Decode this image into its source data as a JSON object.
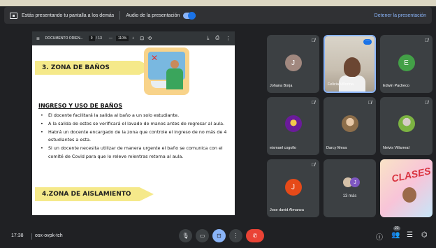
{
  "banner": {
    "presenting_text": "Estás presentando tu pantalla a los demás",
    "audio_label": "Audio de la presentación",
    "audio_on": true,
    "stop_label": "Detener la presentación"
  },
  "doc": {
    "toolbar": {
      "title": "DOCUMENTO ORIEN...",
      "page_current": "9",
      "page_total": "/ 13",
      "zoom_minus": "—",
      "zoom_value": "110%",
      "zoom_plus": "+"
    },
    "zone3_title": "3. ZONA DE BAÑOS",
    "section_title": "INGRESO Y USO DE BAÑOS",
    "bullets": [
      "El docente facilitará la salida al baño a un solo estudiante.",
      "A la salida de estos se verificará el lavado de manos antes de regresar al aula.",
      "Habrá un docente encargado de la zona que controle el ingreso de no más de 4 estudiantes a esta.",
      "Si un docente necesita utilizar de manera urgente el baño se comunica con el comité de Covid para que lo releve mientras retorna al aula."
    ],
    "zone4_title": "4.ZONA DE AISLAMIENTO"
  },
  "participants": [
    {
      "name": "Johana Borja",
      "initial": "J",
      "color": "#a1887f"
    },
    {
      "name": "Felicia Villorina",
      "initial": "",
      "color": ""
    },
    {
      "name": "Edwin Pacheco",
      "initial": "E",
      "color": "#43a047"
    },
    {
      "name": "eismael cogollo",
      "initial": "",
      "color": "#6a1b9a"
    },
    {
      "name": "Darcy Mesa",
      "initial": "",
      "color": "#c49a72"
    },
    {
      "name": "Neivis Villarreal",
      "initial": "",
      "color": "#7cb342"
    },
    {
      "name": "Jose david Almanza",
      "initial": "J",
      "color": "#e64a19"
    },
    {
      "more_label": "13 más",
      "initial": "J"
    },
    {
      "video_text": "CLASES",
      "name": ""
    }
  ],
  "bottom": {
    "time": "17:38",
    "meeting_code": "osx-ovpk-tch",
    "participant_count": "22"
  },
  "icons": {
    "mic": "mic-icon",
    "camera": "camera-icon",
    "present": "present-icon",
    "more": "more-vert-icon",
    "end": "end-call-icon",
    "info": "info-icon",
    "people": "people-icon",
    "chat": "chat-icon",
    "activities": "activities-icon"
  }
}
